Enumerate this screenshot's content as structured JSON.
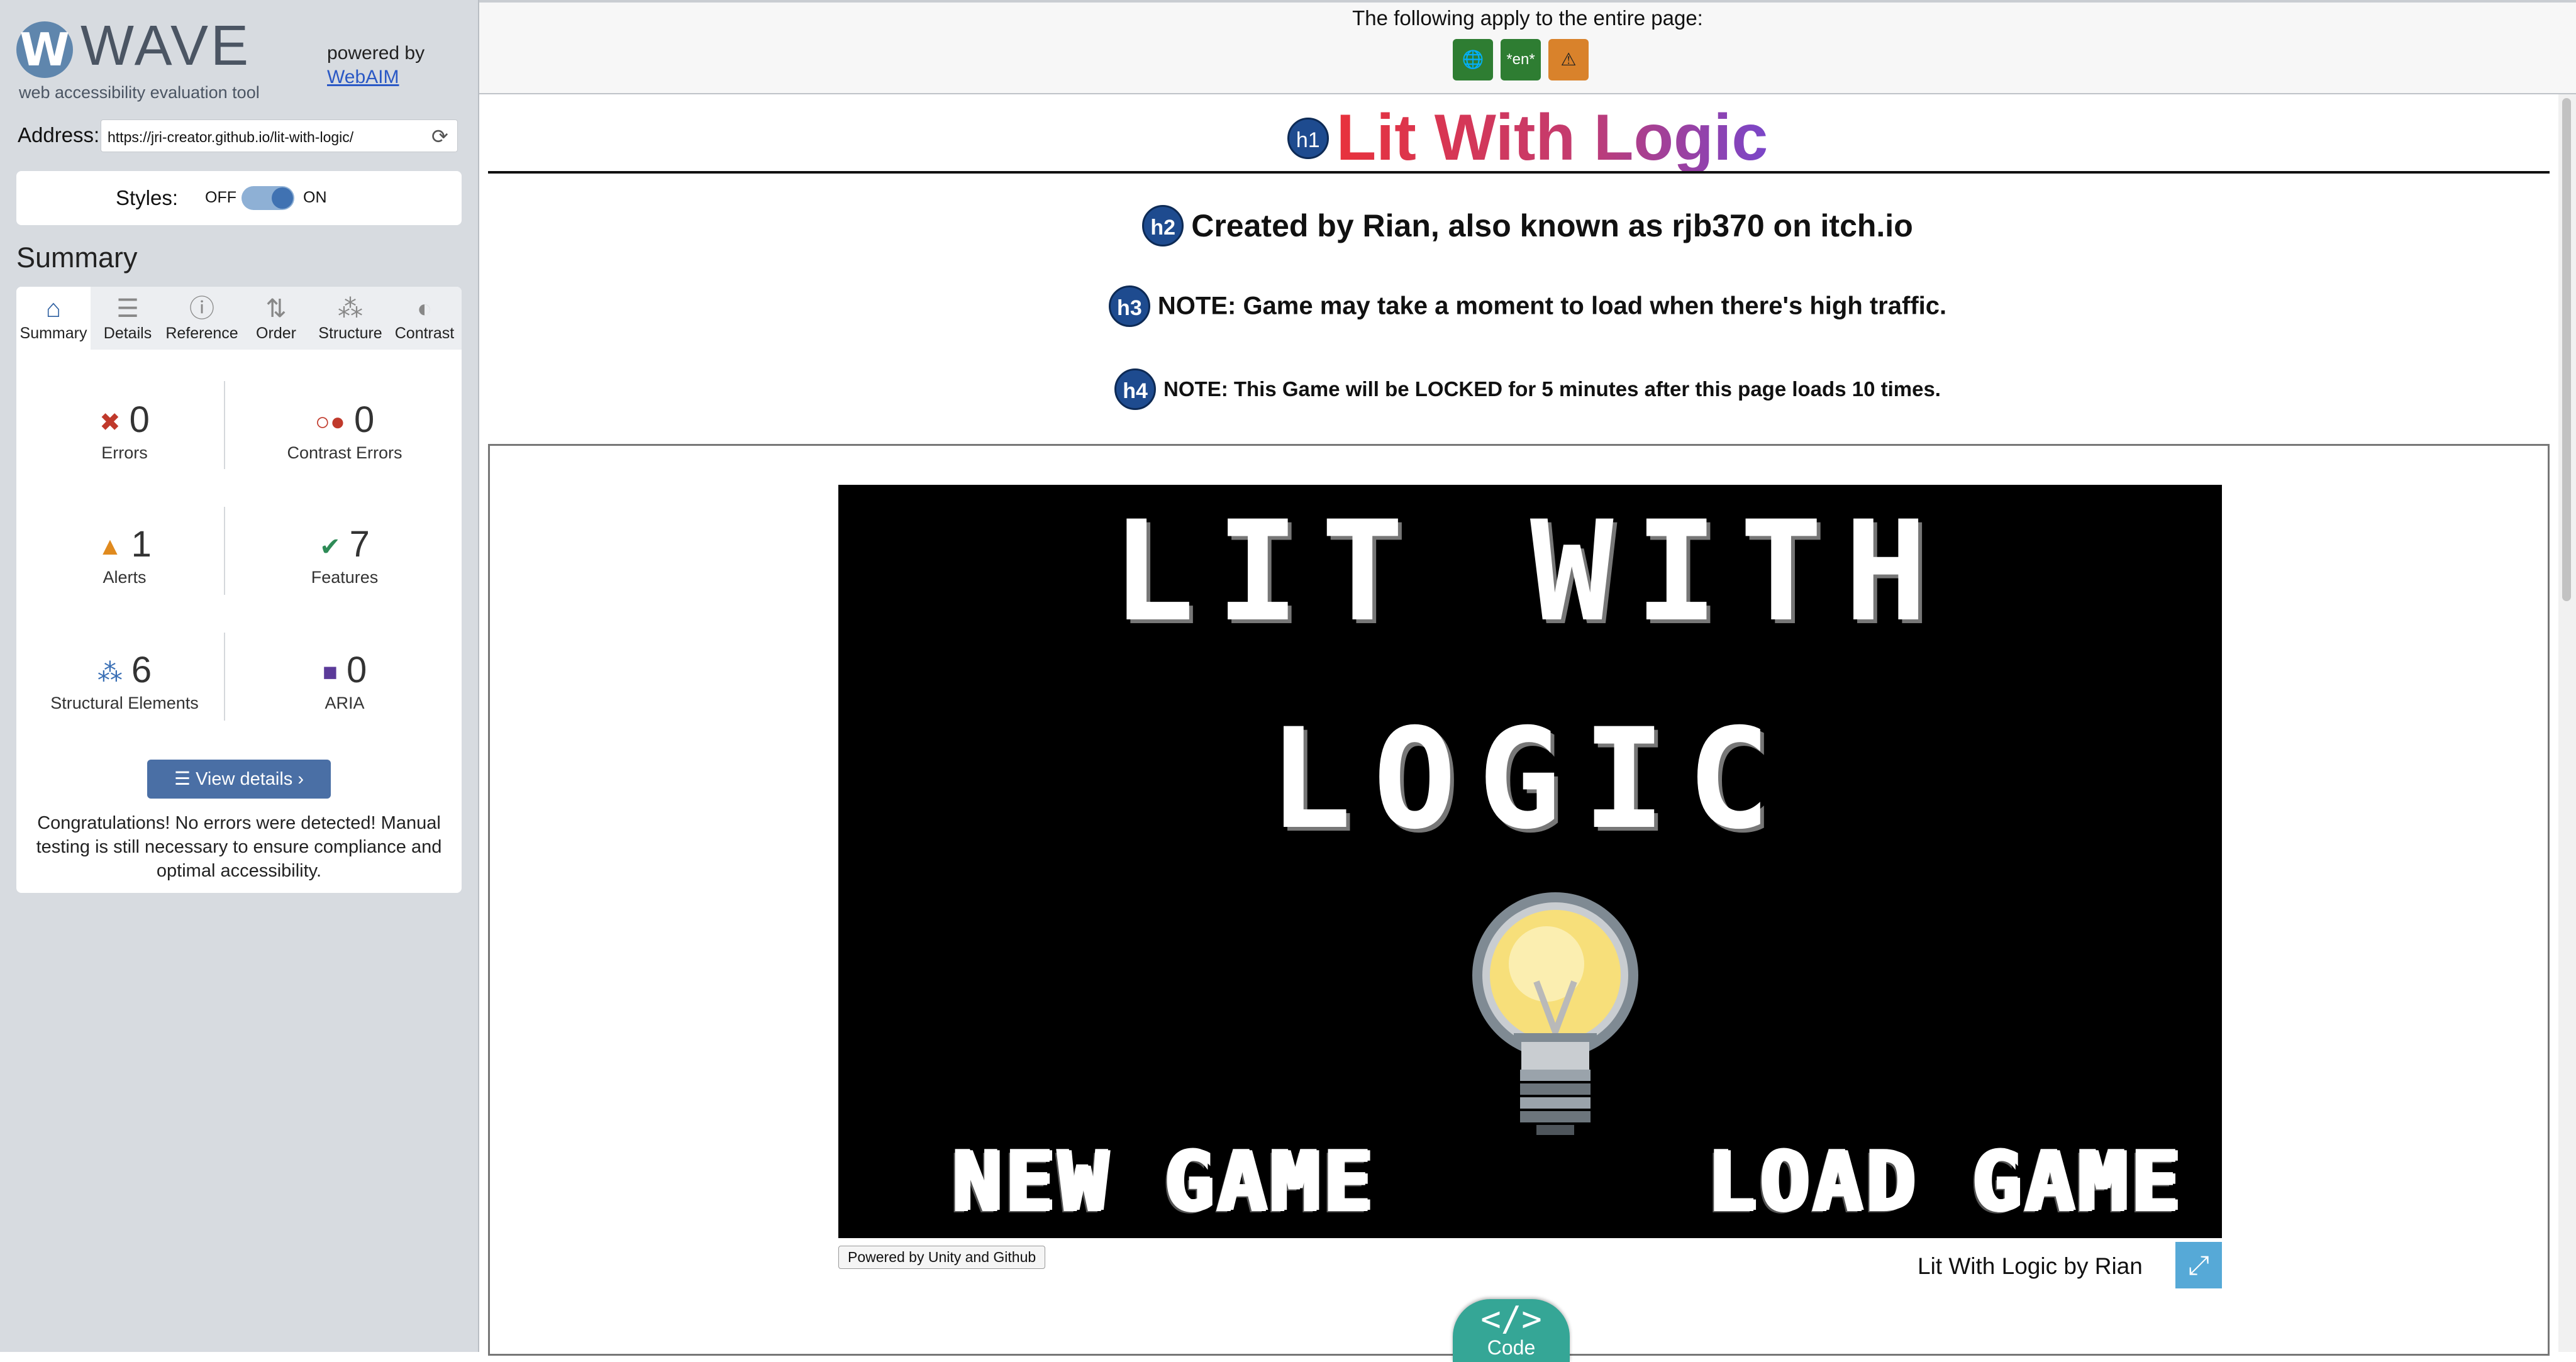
{
  "wave": {
    "logo_letter": "W",
    "logo_text": "WAVE",
    "tagline": "web accessibility evaluation tool",
    "powered_by": "powered by",
    "webaim_link": "WebAIM",
    "address_label": "Address:",
    "address_value": "https://jri-creator.github.io/lit-with-logic/",
    "styles_label": "Styles:",
    "styles_off": "OFF",
    "styles_on": "ON",
    "styles_state": "on",
    "summary_title": "Summary",
    "tabs": [
      {
        "label": "Summary",
        "icon": "home-icon",
        "glyph": "⌂",
        "active": true
      },
      {
        "label": "Details",
        "icon": "list-icon",
        "glyph": "☰",
        "active": false
      },
      {
        "label": "Reference",
        "icon": "info-icon",
        "glyph": "ⓘ",
        "active": false
      },
      {
        "label": "Order",
        "icon": "order-icon",
        "glyph": "⇅",
        "active": false
      },
      {
        "label": "Structure",
        "icon": "structure-icon",
        "glyph": "⁂",
        "active": false
      },
      {
        "label": "Contrast",
        "icon": "contrast-icon",
        "glyph": "◐",
        "active": false
      }
    ],
    "stats": {
      "errors": {
        "count": "0",
        "label": "Errors",
        "icon": "error-icon",
        "color": "#c0392b"
      },
      "contrast": {
        "count": "0",
        "label": "Contrast Errors",
        "icon": "contrast-error-icon",
        "color": "#c0392b"
      },
      "alerts": {
        "count": "1",
        "label": "Alerts",
        "icon": "alert-icon",
        "color": "#e08a1e"
      },
      "features": {
        "count": "7",
        "label": "Features",
        "icon": "feature-icon",
        "color": "#2e8b57"
      },
      "structural": {
        "count": "6",
        "label": "Structural Elements",
        "icon": "structure-icon",
        "color": "#3a6fb5"
      },
      "aria": {
        "count": "0",
        "label": "ARIA",
        "icon": "aria-icon",
        "color": "#5b3a99"
      }
    },
    "view_details": "View details ›",
    "congrats": "Congratulations! No errors were detected! Manual testing is still necessary to ensure compliance and optimal accessibility."
  },
  "page": {
    "applies_text": "The following apply to the entire page:",
    "page_icons": [
      {
        "icon": "language-globe-icon",
        "glyph": "🌐",
        "color": "#2e7d32"
      },
      {
        "icon": "lang-en-icon",
        "text": "*en*",
        "color": "#2e7d32"
      },
      {
        "icon": "page-alert-icon",
        "glyph": "⚠",
        "color": "#d9822b"
      }
    ],
    "h1_badge": "h1",
    "h1": "Lit With Logic",
    "h2_badge": "h2",
    "h2": "Created by Rian, also known as rjb370 on itch.io",
    "h3_badge": "h3",
    "h3": "NOTE: Game may take a moment to load when there's high traffic.",
    "h4_badge": "h4",
    "h4": "NOTE: This Game will be LOCKED for 5 minutes after this page loads 10 times."
  },
  "game": {
    "title_line1": "LIT WITH",
    "title_line2": "LOGIC",
    "new_game": "NEW GAME",
    "load_game": "LOAD GAME",
    "powered_badge": "Powered by Unity and Github",
    "credit": "Lit With Logic by Rian",
    "fullscreen_icon": "fullscreen-icon"
  },
  "code_tab": {
    "glyph": "</>",
    "label": "Code"
  }
}
